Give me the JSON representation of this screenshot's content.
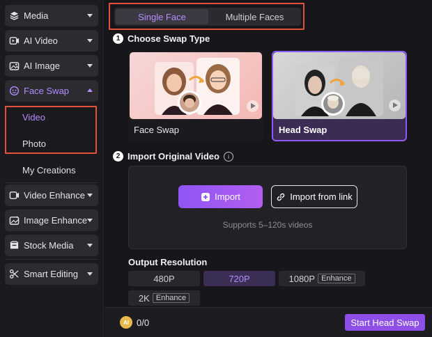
{
  "sidebar": {
    "items": [
      {
        "label": "Media",
        "icon": "media-icon"
      },
      {
        "label": "AI Video",
        "icon": "ai-video-icon"
      },
      {
        "label": "AI Image",
        "icon": "ai-image-icon"
      },
      {
        "label": "Face Swap",
        "icon": "face-swap-icon"
      },
      {
        "label": "Video Enhance",
        "icon": "video-enhance-icon"
      },
      {
        "label": "Image Enhance",
        "icon": "image-enhance-icon"
      },
      {
        "label": "Stock Media",
        "icon": "stock-media-icon"
      },
      {
        "label": "Smart Editing",
        "icon": "smart-editing-icon"
      }
    ],
    "face_swap_sub": [
      {
        "label": "Video"
      },
      {
        "label": "Photo"
      }
    ],
    "my_creations": "My Creations",
    "accent": "#b48cff"
  },
  "tabs": [
    {
      "label": "Single Face",
      "selected": true
    },
    {
      "label": "Multiple Faces",
      "selected": false
    }
  ],
  "step1": {
    "number": "1",
    "title": "Choose Swap Type"
  },
  "swap_types": [
    {
      "label": "Face Swap",
      "selected": false
    },
    {
      "label": "Head Swap",
      "selected": true
    }
  ],
  "step2": {
    "number": "2",
    "title": "Import Original Video",
    "info_icon": "info-icon"
  },
  "import": {
    "import_label": "Import",
    "link_label": "Import from link",
    "supports": "Supports 5–120s videos"
  },
  "resolution": {
    "title": "Output Resolution",
    "options": [
      {
        "label": "480P",
        "tag": ""
      },
      {
        "label": "720P",
        "tag": "",
        "selected": true
      },
      {
        "label": "1080P",
        "tag": "Enhance"
      },
      {
        "label": "2K",
        "tag": "Enhance"
      }
    ]
  },
  "footer": {
    "badge": "AI",
    "credits": "0/0",
    "start_label": "Start Head Swap",
    "start_color": "#8d4fe8"
  }
}
